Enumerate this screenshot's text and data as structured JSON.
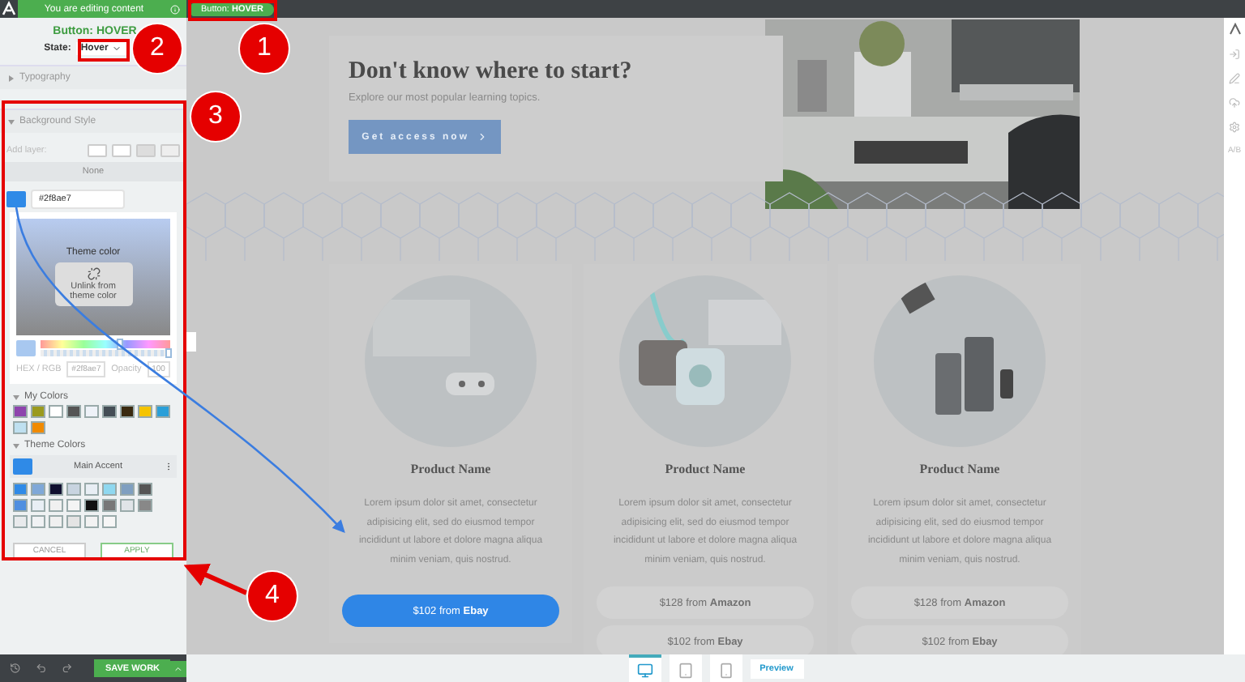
{
  "top_bar": {
    "message": "You are editing content",
    "breadcrumb": "Button: **HOVER**"
  },
  "panel": {
    "title": "Button: HOVER",
    "state_label": "State:",
    "state_value": "Hover",
    "sections": [
      {
        "label": "Typography",
        "expanded": false
      },
      {
        "label": "Background Style",
        "expanded": true
      }
    ],
    "hue_slider": {
      "level": 0.6
    },
    "opacity_slider": {
      "level": 1
    },
    "add_layer": "Add layer:",
    "layer_value": "None",
    "hex": "#2f8ae7",
    "theme_color_label": "Theme color",
    "unlink": "Unlink from theme color",
    "hex_rgb_label": "HEX / RGB",
    "hex_field": "#2f8ae7",
    "opacity_label": "Opacity",
    "opacity_value": "100",
    "my_colors_label": "My Colors",
    "my_colors": [
      {
        "color": "#8e44ad"
      },
      {
        "color": "#9a9a1e"
      },
      {
        "color": "#ffffff"
      },
      {
        "color": "#555555"
      },
      {
        "color": "#eef2f8"
      },
      {
        "color": "#444d55"
      },
      {
        "color": "#3a2a10"
      },
      {
        "color": "#f5c400"
      },
      {
        "color": "#2a9fd8"
      },
      {
        "color": "#bfe0f0"
      },
      {
        "color": "#f08a00"
      }
    ],
    "theme_colors_label": "Theme Colors",
    "accent_name": "Main Accent",
    "theme_swatches": [
      {
        "color": "#2f8ae7"
      },
      {
        "color": "#7fa8d8"
      },
      {
        "color": "#101030"
      },
      {
        "color": "#c8d4e0"
      },
      {
        "color": "#e8eef4"
      },
      {
        "color": "#8fd8f0"
      },
      {
        "color": "#7f9fc0"
      },
      {
        "color": "#555555"
      },
      {
        "color": "#4f8fe0"
      },
      {
        "color": "#e8eef4"
      },
      {
        "color": "#f0f0f0"
      },
      {
        "color": "#f4f4f4"
      },
      {
        "color": "#111111"
      },
      {
        "color": "#777777"
      },
      {
        "color": "#e0e4e8"
      },
      {
        "color": "#888888"
      },
      {
        "color": "#e8eaec"
      },
      {
        "color": "#f0f2f4"
      },
      {
        "color": "#f0f0f0"
      },
      {
        "color": "#e4e4e4"
      },
      {
        "color": "#f2f2f2"
      },
      {
        "color": "#f6f6f6"
      }
    ],
    "cancel": "CANCEL",
    "apply": "APPLY"
  },
  "bottom_bar": {
    "save": "SAVE WORK"
  },
  "hero": {
    "title": "Don't know where to start?",
    "subtitle": "Explore our most popular learning topics.",
    "cta": "Get access now"
  },
  "products": [
    {
      "name": "Product Name",
      "description": "Lorem ipsum dolor sit amet, consectetur adipisicing elit, sed do eiusmod tempor incididunt ut labore et dolore magna aliqua minim veniam, quis nostrud.",
      "buttons": [
        {
          "text": "$102 from **Ebay**",
          "hover": true
        }
      ]
    },
    {
      "name": "Product Name",
      "description": "Lorem ipsum dolor sit amet, consectetur adipisicing elit, sed do eiusmod tempor incididunt ut labore et dolore magna aliqua minim veniam, quis nostrud.",
      "buttons": [
        {
          "text": "$128 from **Amazon**",
          "hover": false
        },
        {
          "text": "$102 from **Ebay**",
          "hover": false
        }
      ]
    },
    {
      "name": "Product Name",
      "description": "Lorem ipsum dolor sit amet, consectetur adipisicing elit, sed do eiusmod tempor incididunt ut labore et dolore magna aliqua minim veniam, quis nostrud.",
      "buttons": [
        {
          "text": "$128 from **Amazon**",
          "hover": false
        },
        {
          "text": "$102 from **Ebay**",
          "hover": false
        }
      ]
    }
  ],
  "device_tabs": [
    {
      "kind": "desktop",
      "selected": true
    },
    {
      "kind": "tablet",
      "selected": false
    },
    {
      "kind": "phone",
      "selected": false
    }
  ],
  "preview": "Preview",
  "rail_label": "A/B",
  "steps": [
    "1",
    "2",
    "3",
    "4"
  ]
}
